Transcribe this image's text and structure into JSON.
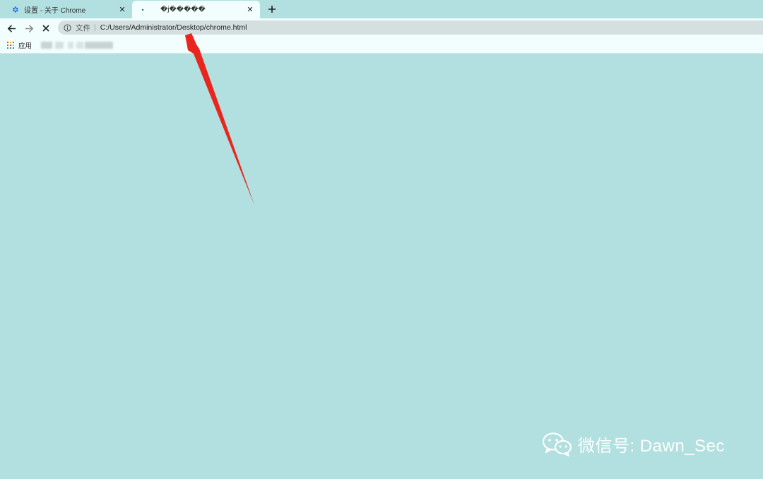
{
  "tabs": [
    {
      "title": "设置 - 关于 Chrome",
      "favicon": "settings-gear-icon",
      "active": false
    },
    {
      "title": "�j�����",
      "favicon": "loading-dot",
      "active": true
    }
  ],
  "toolbar": {
    "omnibox_scheme": "文件",
    "omnibox_url": "C:/Users/Administrator/Desktop/chrome.html"
  },
  "bookmarks": {
    "apps_label": "应用"
  },
  "watermark": {
    "text": "微信号: Dawn_Sec",
    "icon": "wechat-icon"
  },
  "colors": {
    "background": "#b2dfdf",
    "chrome_bar": "#f2fdfd",
    "omnibox": "#d4dfdf",
    "annotation_arrow": "#e8261e",
    "settings_icon": "#1a73e8"
  }
}
